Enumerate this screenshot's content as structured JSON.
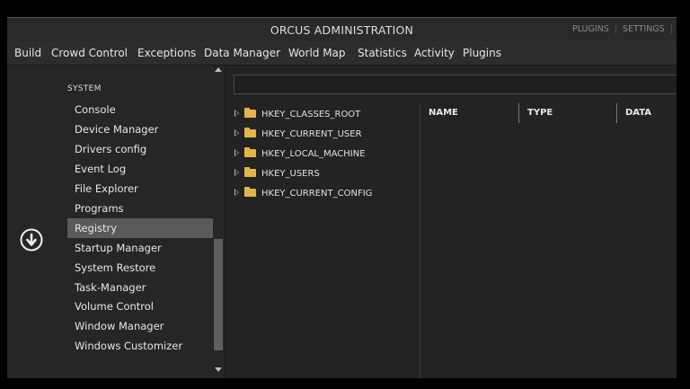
{
  "window": {
    "title": "ORCUS ADMINISTRATION",
    "actions": [
      "PLUGINS",
      "SETTINGS"
    ]
  },
  "menu": [
    "Build",
    "Crowd Control",
    "Exceptions",
    "Data Manager",
    "World Map",
    "Statistics",
    "Activity",
    "Plugins"
  ],
  "sidebar": {
    "section": "SYSTEM",
    "items": [
      {
        "label": "Console"
      },
      {
        "label": "Device Manager"
      },
      {
        "label": "Drivers config"
      },
      {
        "label": "Event Log"
      },
      {
        "label": "File Explorer"
      },
      {
        "label": "Programs"
      },
      {
        "label": "Registry",
        "selected": true
      },
      {
        "label": "Startup Manager"
      },
      {
        "label": "System Restore"
      },
      {
        "label": "Task-Manager"
      },
      {
        "label": "Volume Control"
      },
      {
        "label": "Window Manager"
      },
      {
        "label": "Windows Customizer"
      }
    ],
    "nav_icon": "arrow-down-circle-icon"
  },
  "registry": {
    "path_value": "",
    "hives": [
      "HKEY_CLASSES_ROOT",
      "HKEY_CURRENT_USER",
      "HKEY_LOCAL_MACHINE",
      "HKEY_USERS",
      "HKEY_CURRENT_CONFIG"
    ],
    "columns": [
      "NAME",
      "TYPE",
      "DATA"
    ]
  },
  "colors": {
    "background": "#252525",
    "selection": "#5a5a5a",
    "folder": "#e4b54a"
  }
}
